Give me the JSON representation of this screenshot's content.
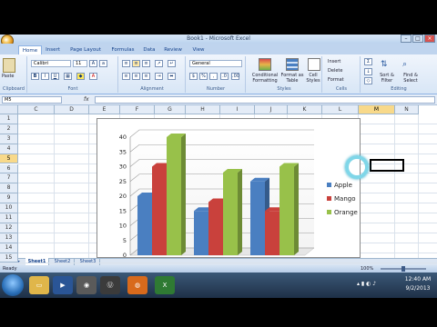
{
  "window": {
    "title": "Book1 - Microsoft Excel"
  },
  "tabs": [
    "Home",
    "Insert",
    "Page Layout",
    "Formulas",
    "Data",
    "Review",
    "View"
  ],
  "ribbon": {
    "paste_label": "Paste",
    "font_name": "Calibri",
    "font_size": "11",
    "number_format": "General",
    "bold": "B",
    "italic": "I",
    "underline": "U",
    "buttons": {
      "conditional": "Conditional Formatting",
      "format_table": "Format as Table",
      "cell_styles": "Cell Styles",
      "insert": "Insert",
      "delete": "Delete",
      "format": "Format",
      "sort_filter": "Sort & Filter",
      "find_select": "Find & Select"
    },
    "groups": [
      "Clipboard",
      "Font",
      "Alignment",
      "Number",
      "Styles",
      "Cells",
      "Editing"
    ]
  },
  "formula_bar": {
    "name_box": "M5",
    "fx": "fx",
    "content": ""
  },
  "grid": {
    "columns": [
      "C",
      "D",
      "E",
      "F",
      "G",
      "H",
      "I",
      "J",
      "K",
      "L",
      "M",
      "N"
    ],
    "rows": [
      "1",
      "2",
      "3",
      "4",
      "5",
      "6",
      "7",
      "8",
      "9",
      "10",
      "11",
      "12",
      "13",
      "14",
      "15"
    ],
    "selected_column": "M",
    "selected_row": "5"
  },
  "sheet_tabs": [
    "Sheet1",
    "Sheet2",
    "Sheet3"
  ],
  "status": {
    "mode": "Ready",
    "zoom": "100%"
  },
  "taskbar": {
    "time": "12:40 AM",
    "date": "9/2/2013"
  },
  "chart_data": {
    "type": "bar",
    "categories": [
      "",
      "",
      ""
    ],
    "series": [
      {
        "name": "Apple",
        "values": [
          20,
          15,
          25
        ],
        "color": "#4a7fc1"
      },
      {
        "name": "Mango",
        "values": [
          30,
          18,
          15
        ],
        "color": "#c9413c"
      },
      {
        "name": "Orange",
        "values": [
          40,
          28,
          30
        ],
        "color": "#98c14a"
      }
    ],
    "ylim": [
      0,
      40
    ],
    "yticks": [
      "0",
      "5",
      "10",
      "15",
      "20",
      "25",
      "30",
      "35",
      "40"
    ],
    "grid": true,
    "legend": "right",
    "three_d": true
  }
}
